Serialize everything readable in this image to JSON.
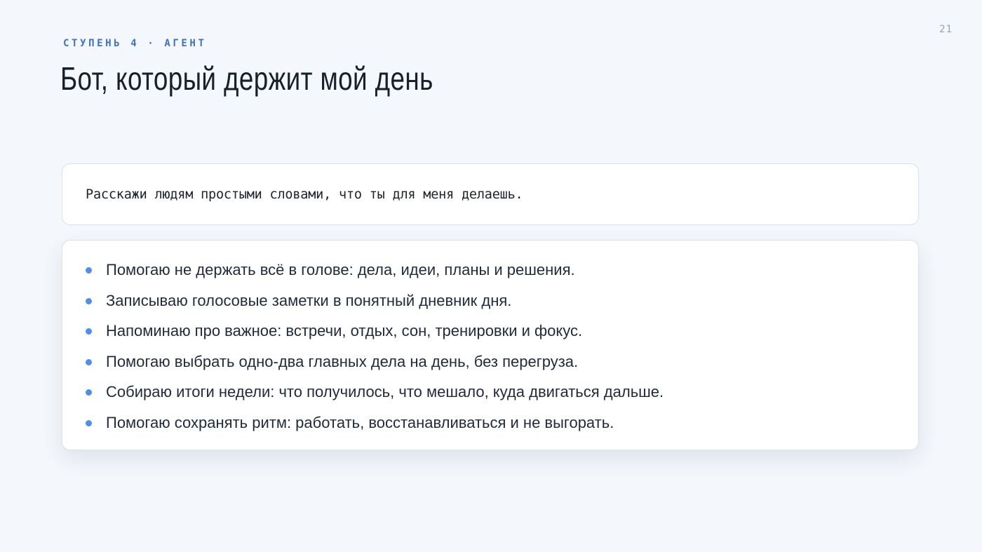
{
  "slide": {
    "page_number": "21",
    "eyebrow": "СТУПЕНЬ 4 · АГЕНТ",
    "title": "Бот, который держит мой день"
  },
  "prompt": {
    "text": "Расскажи людям простыми словами, что ты для меня делаешь."
  },
  "answer": {
    "bullet_color": "#4f8ef0",
    "items": [
      "Помогаю не держать всё в голове: дела, идеи, планы и решения.",
      "Записываю голосовые заметки в понятный дневник дня.",
      "Напоминаю про важное: встречи, отдых, сон, тренировки и фокус.",
      "Помогаю выбрать одно-два главных дела на день, без перегруза.",
      "Собираю итоги недели: что получилось, что мешало, куда двигаться дальше.",
      "Помогаю сохранять ритм: работать, восстанавливаться и не выгорать."
    ]
  },
  "colors": {
    "background": "#f4f7fb",
    "accent": "#3e72c4",
    "card_border": "#d9e0e9",
    "text": "#1f2b3a"
  }
}
